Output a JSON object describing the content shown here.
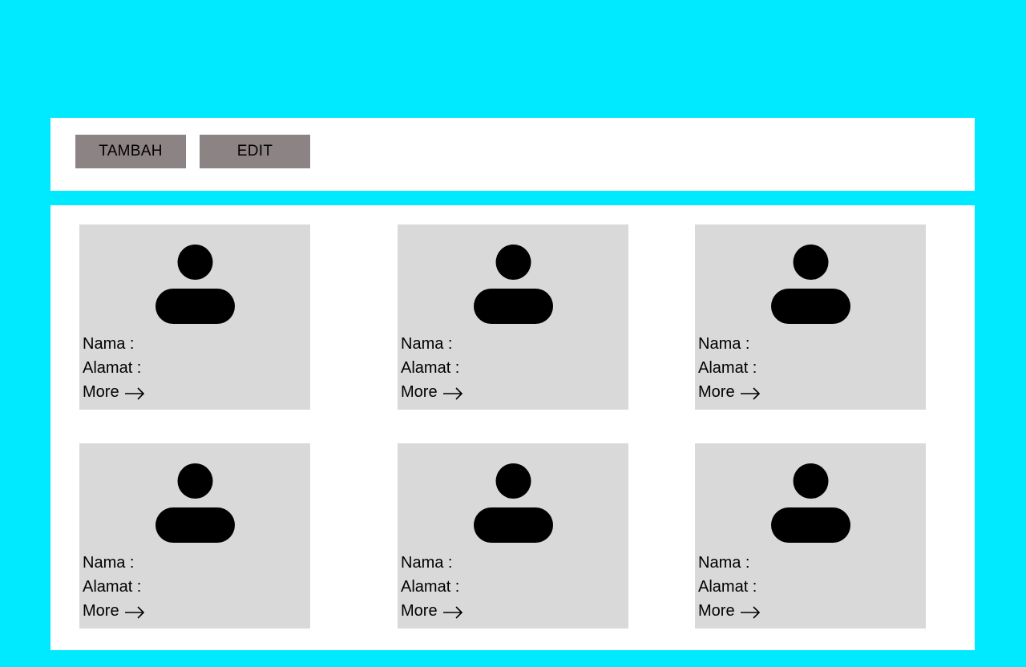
{
  "toolbar": {
    "tambah_label": "TAMBAH",
    "edit_label": "EDIT"
  },
  "cards": [
    {
      "nama_label": "Nama :",
      "alamat_label": "Alamat :",
      "more_label": "More",
      "icon": "user-avatar-icon"
    },
    {
      "nama_label": "Nama :",
      "alamat_label": "Alamat :",
      "more_label": "More",
      "icon": "user-avatar-icon"
    },
    {
      "nama_label": "Nama :",
      "alamat_label": "Alamat :",
      "more_label": "More",
      "icon": "user-avatar-icon"
    },
    {
      "nama_label": "Nama :",
      "alamat_label": "Alamat :",
      "more_label": "More",
      "icon": "user-avatar-icon"
    },
    {
      "nama_label": "Nama :",
      "alamat_label": "Alamat :",
      "more_label": "More",
      "icon": "user-avatar-icon"
    },
    {
      "nama_label": "Nama :",
      "alamat_label": "Alamat :",
      "more_label": "More",
      "icon": "user-avatar-icon"
    }
  ],
  "colors": {
    "background": "#00eaff",
    "panel": "#ffffff",
    "button": "#8c8384",
    "card": "#d9d9d9",
    "text": "#000000"
  }
}
